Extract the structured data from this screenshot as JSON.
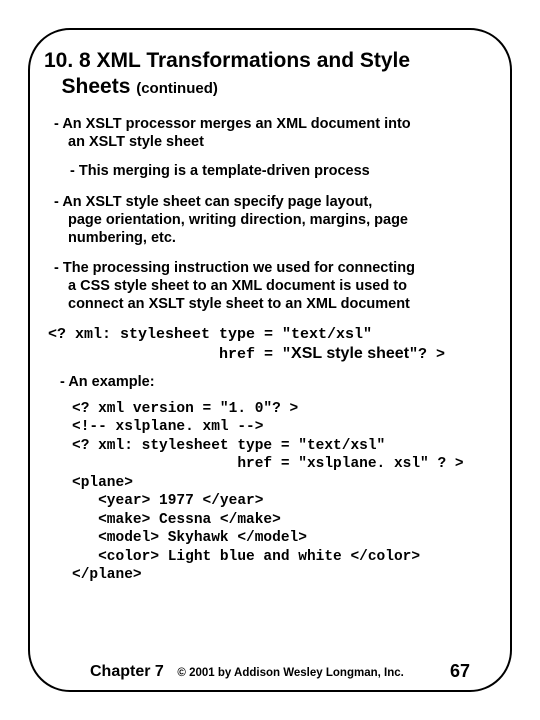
{
  "title_line1": "10. 8 XML Transformations and Style",
  "title_line2": "Sheets ",
  "title_cont": "(continued)",
  "b1_l1": "- An XSLT processor merges an XML document into",
  "b1_l2": "an XSLT style sheet",
  "sub1": "- This merging is a template-driven process",
  "b2_l1": "- An XSLT style sheet can specify page layout,",
  "b2_l2": "page orientation, writing direction, margins, page",
  "b2_l3": "numbering, etc.",
  "b3_l1": "- The processing instruction we used for connecting",
  "b3_l2": "a CSS style sheet to an XML document is used to",
  "b3_l3": "connect an XSLT style sheet to an XML document",
  "code1_l1": "<? xml: stylesheet type = \"text/xsl\"",
  "code1_l2_a": "                   href = \"",
  "code1_l2_big": "XSL style sheet",
  "code1_l2_b": "\"? >",
  "example_label": "- An example:",
  "code2_l1": "<? xml version = \"1. 0\"? >",
  "code2_l2": "<!-- xslplane. xml -->",
  "code2_l3": "<? xml: stylesheet type = \"text/xsl\"",
  "code2_l4": "                   href = \"xslplane. xsl\" ? >",
  "code2_l5": "<plane>",
  "code2_l6": "   <year> 1977 </year>",
  "code2_l7": "   <make> Cessna </make>",
  "code2_l8": "   <model> Skyhawk </model>",
  "code2_l9": "   <color> Light blue and white </color>",
  "code2_l10": "</plane>",
  "footer_chapter": "Chapter 7",
  "footer_copy": "© 2001 by Addison Wesley Longman, Inc.",
  "footer_page": "67"
}
